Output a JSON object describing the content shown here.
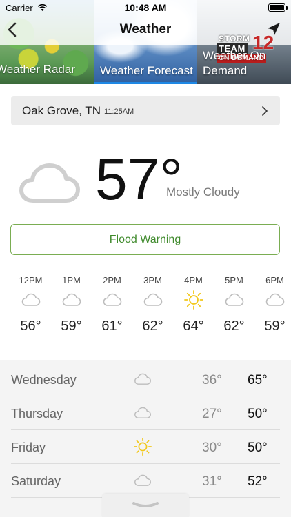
{
  "status_bar": {
    "carrier": "Carrier",
    "time": "10:48 AM",
    "battery_level": 1.0
  },
  "header": {
    "title": "Weather",
    "tabs": [
      {
        "label": "Weather Radar",
        "active": false
      },
      {
        "label": "Weather Forecast",
        "active": true
      },
      {
        "label": "Weather On Demand",
        "active": false
      }
    ],
    "storm_logo": {
      "line1": "STORM",
      "line2": "TEAM",
      "line3": "ON DEMAND",
      "number": "12"
    }
  },
  "location": {
    "name": "Oak Grove, TN",
    "updated": "11:25AM"
  },
  "current": {
    "temp": "57°",
    "condition": "Mostly Cloudy"
  },
  "alert": {
    "label": "Flood Warning"
  },
  "hourly": [
    {
      "time": "12PM",
      "icon": "cloud-icon",
      "temp": "56°"
    },
    {
      "time": "1PM",
      "icon": "cloud-icon",
      "temp": "59°"
    },
    {
      "time": "2PM",
      "icon": "cloud-icon",
      "temp": "61°"
    },
    {
      "time": "3PM",
      "icon": "cloud-icon",
      "temp": "62°"
    },
    {
      "time": "4PM",
      "icon": "sun-icon",
      "temp": "64°"
    },
    {
      "time": "5PM",
      "icon": "cloud-icon",
      "temp": "62°"
    },
    {
      "time": "6PM",
      "icon": "cloud-icon",
      "temp": "59°"
    }
  ],
  "daily": [
    {
      "day": "Wednesday",
      "icon": "cloud-icon",
      "low": "36°",
      "high": "65°"
    },
    {
      "day": "Thursday",
      "icon": "cloud-icon",
      "low": "27°",
      "high": "50°"
    },
    {
      "day": "Friday",
      "icon": "sun-icon",
      "low": "30°",
      "high": "50°"
    },
    {
      "day": "Saturday",
      "icon": "cloud-icon",
      "low": "31°",
      "high": "52°"
    }
  ],
  "colors": {
    "accent": "#1e88e5",
    "warning_green": "#3f8a2c",
    "sun_yellow": "#f2c81b"
  }
}
